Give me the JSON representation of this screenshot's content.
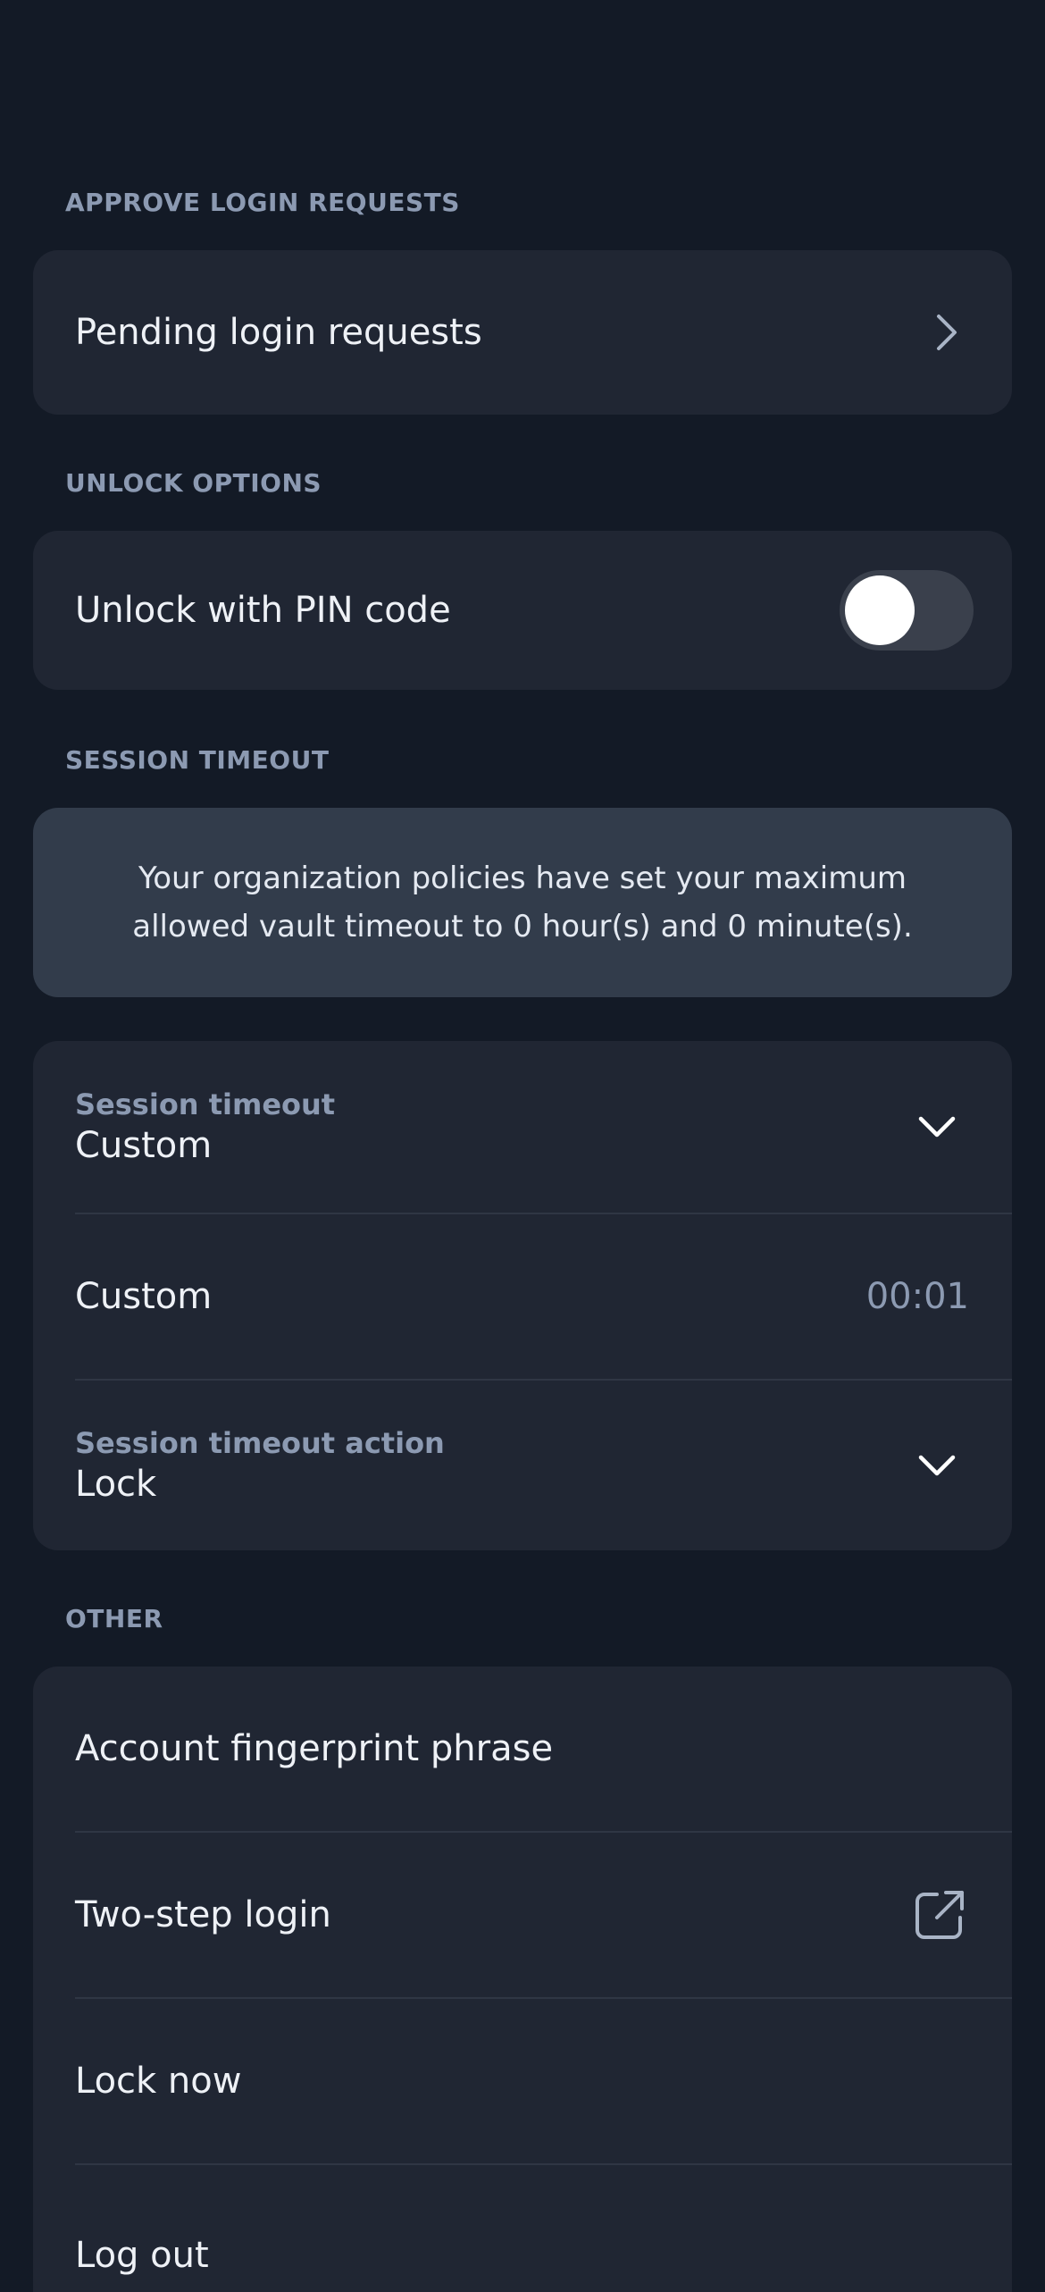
{
  "sections": {
    "approve_login_requests": "APPROVE LOGIN REQUESTS",
    "unlock_options": "UNLOCK OPTIONS",
    "session_timeout": "SESSION TIMEOUT",
    "other": "OTHER"
  },
  "approve": {
    "pending_label": "Pending login requests"
  },
  "unlock": {
    "pin_label": "Unlock with PIN code",
    "pin_enabled": false
  },
  "session": {
    "policy_text": "Your organization policies have set your maximum allowed vault timeout to 0 hour(s) and 0 minute(s).",
    "timeout_label": "Session timeout",
    "timeout_value": "Custom",
    "custom_label": "Custom",
    "custom_value": "00:01",
    "action_label": "Session timeout action",
    "action_value": "Lock"
  },
  "other": {
    "fingerprint_label": "Account fingerprint phrase",
    "two_step_label": "Two-step login",
    "lock_now_label": "Lock now",
    "log_out_label": "Log out"
  },
  "colors": {
    "background": "#131a26",
    "card": "#202633",
    "info_box": "#323c4b",
    "muted_text": "#8c9ab2"
  }
}
